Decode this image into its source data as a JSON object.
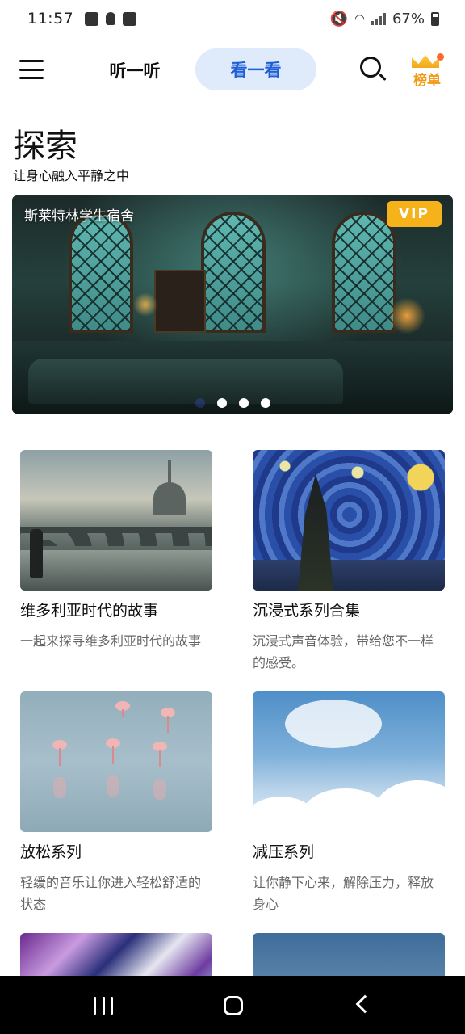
{
  "status_bar": {
    "time": "11:57",
    "battery": "67%",
    "left_icons": [
      "gallery-icon",
      "bulb-icon",
      "checkbox-icon"
    ],
    "right_icons": [
      "mute-icon",
      "wifi-icon",
      "signal-icon",
      "battery-icon"
    ]
  },
  "top_nav": {
    "tabs": [
      {
        "label": "听一听",
        "active": false
      },
      {
        "label": "看一看",
        "active": true
      }
    ],
    "rank_label": "榜单",
    "accent_color": "#1f5fd6",
    "active_tab_bg": "#dfeafb"
  },
  "header": {
    "title": "探索",
    "subtitle": "让身心融入平静之中"
  },
  "banner": {
    "title": "斯莱特林学生宿舍",
    "badge": "VIP",
    "badge_color": "#f5b21b",
    "page_count": 4,
    "active_page": 1
  },
  "collections": [
    {
      "title": "维多利亚时代的故事",
      "desc": "一起来探寻维多利亚时代的故事",
      "image": "victorian-city-image"
    },
    {
      "title": "沉浸式系列合集",
      "desc": "沉浸式声音体验，带给您不一样的感受。",
      "image": "starry-night-image"
    },
    {
      "title": "放松系列",
      "desc": "轻缓的音乐让你进入轻松舒适的状态",
      "image": "flamingo-image"
    },
    {
      "title": "减压系列",
      "desc": "让你静下心来，解除压力，释放身心",
      "image": "clouds-image"
    },
    {
      "title": "",
      "desc": "",
      "image": "marble-image"
    },
    {
      "title": "",
      "desc": "",
      "image": "sunset-image"
    }
  ],
  "system_nav": [
    "recent-apps-icon",
    "home-icon",
    "back-icon"
  ]
}
